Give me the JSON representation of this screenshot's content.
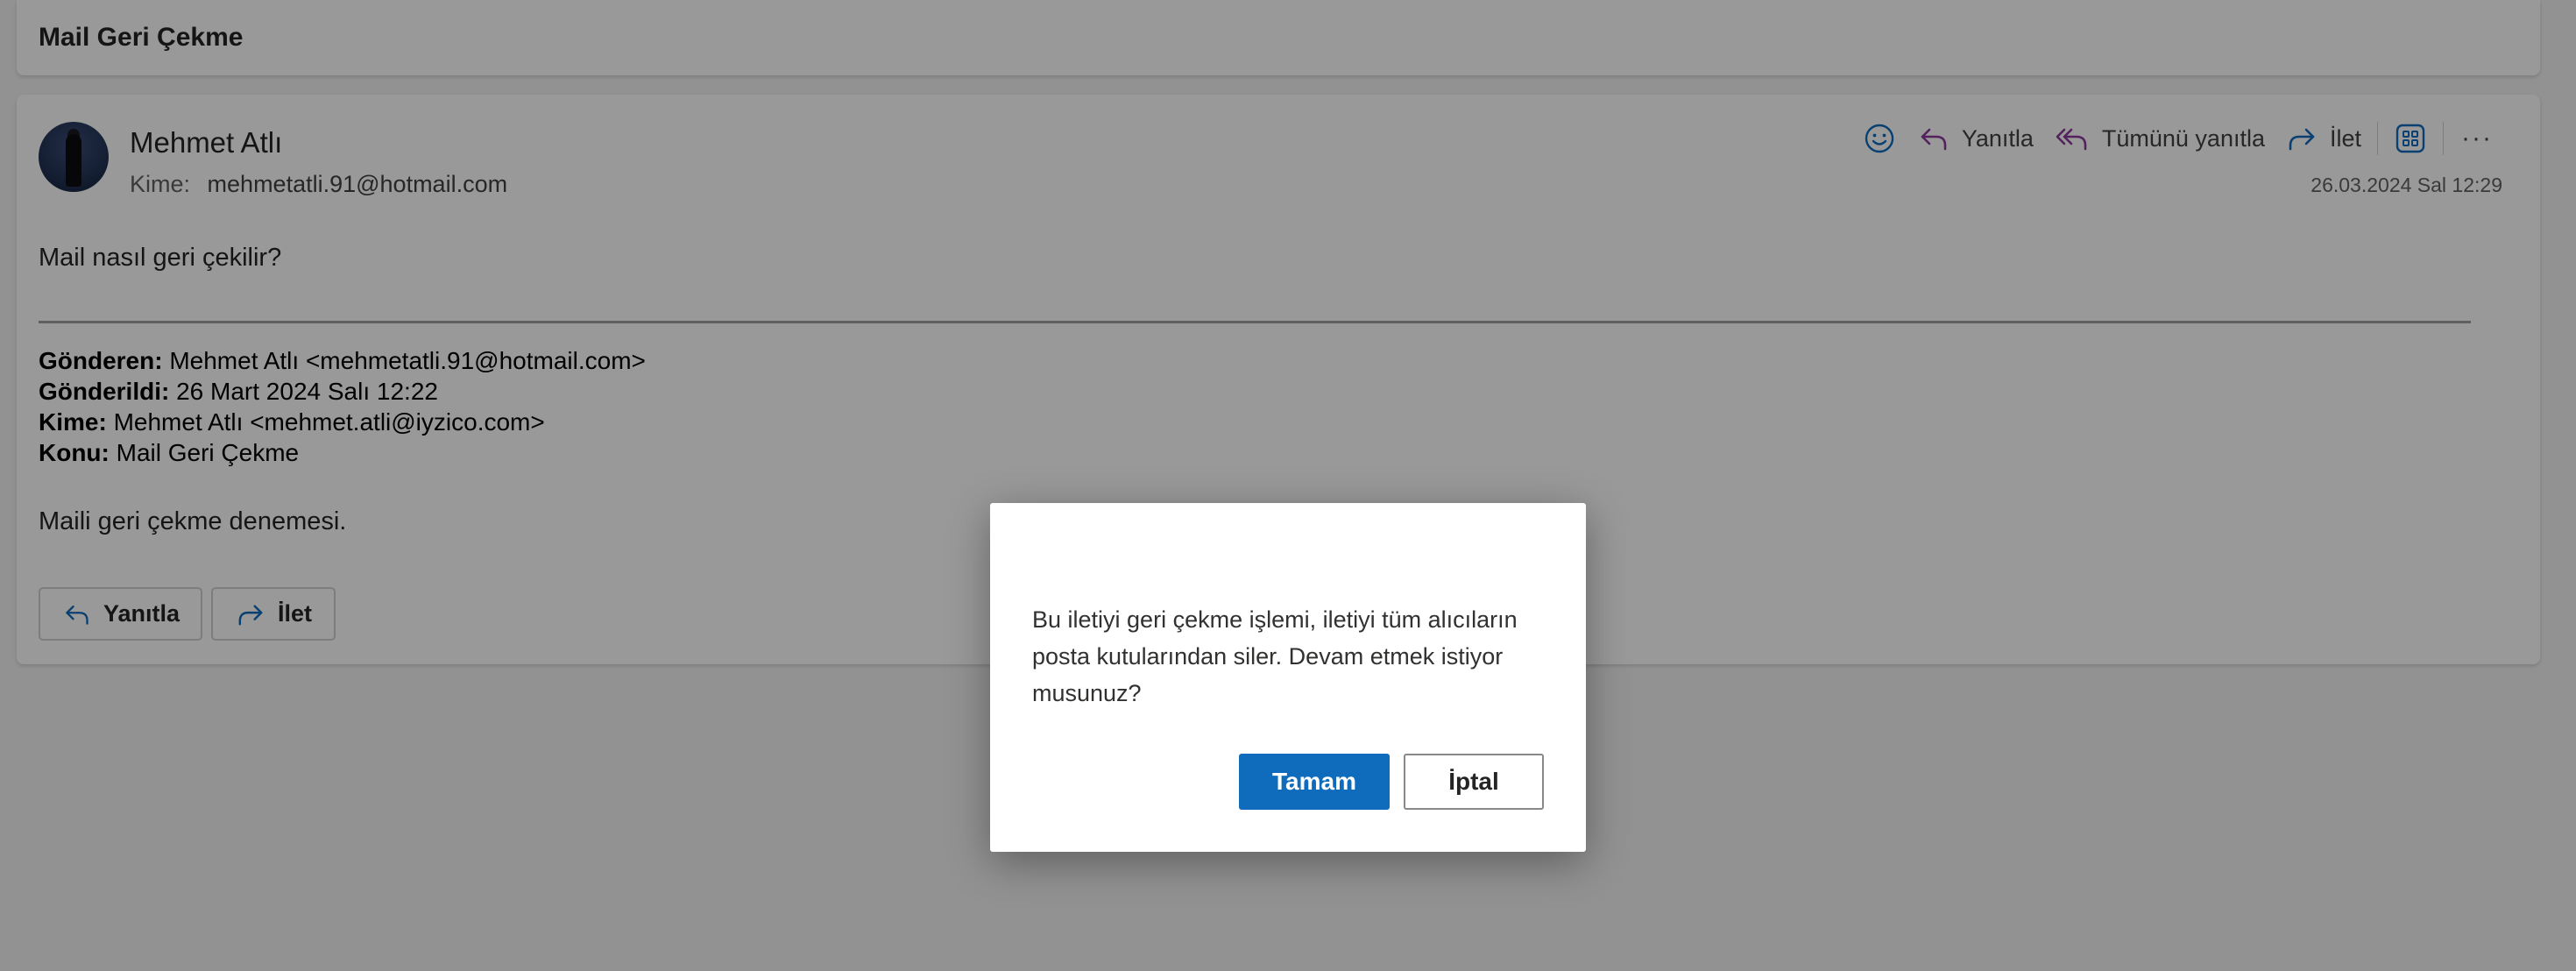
{
  "subject": {
    "title": "Mail Geri Çekme"
  },
  "message": {
    "sender_name": "Mehmet Atlı",
    "recipient_label": "Kime:",
    "recipient_email": "mehmetatli.91@hotmail.com",
    "timestamp": "26.03.2024 Sal 12:29",
    "actions": {
      "emoji_icon": "emoji-smile-icon",
      "reply_label": "Yanıtla",
      "reply_all_label": "Tümünü yanıtla",
      "forward_label": "İlet",
      "apps_icon": "apps-grid-icon",
      "more_icon": "more-horizontal-icon",
      "more_glyph": "···"
    },
    "body_question": "Mail nasıl geri çekilir?",
    "forwarded": [
      {
        "key": "Gönderen:",
        "value": " Mehmet Atlı <mehmetatli.91@hotmail.com>"
      },
      {
        "key": "Gönderildi:",
        "value": " 26 Mart 2024 Salı 12:22"
      },
      {
        "key": "Kime:",
        "value": " Mehmet Atlı <mehmet.atli@iyzico.com>"
      },
      {
        "key": "Konu:",
        "value": " Mail Geri Çekme"
      }
    ],
    "body_trial": "Maili geri çekme denemesi.",
    "quick_reply_label": "Yanıtla",
    "quick_forward_label": "İlet"
  },
  "dialog": {
    "message": "Bu iletiyi geri çekme işlemi, iletiyi tüm alıcıların posta kutularından siler. Devam etmek istiyor musunuz?",
    "ok_label": "Tamam",
    "cancel_label": "İptal"
  },
  "colors": {
    "accent": "#0f6cbd",
    "reply_all_icon": "#8a3a9b",
    "overlay": "rgba(0,0,0,0.40)"
  }
}
